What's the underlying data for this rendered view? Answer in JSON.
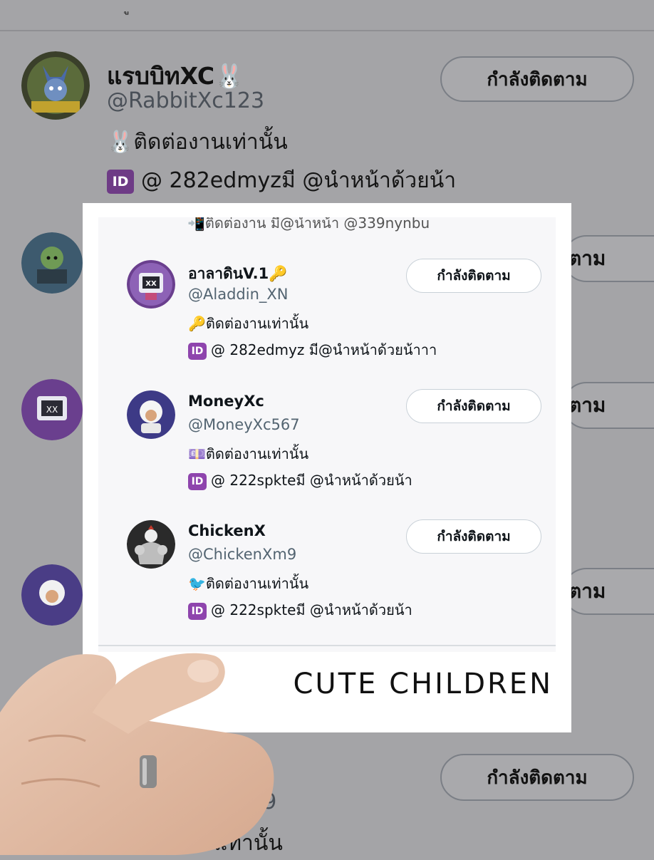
{
  "background": {
    "top_glyph": "ู",
    "first": {
      "name": "แรบบิทXC🐰",
      "handle": "@RabbitXc123",
      "bio": "🐰ติดต่องานเท่านั้น",
      "id_badge": "ID",
      "id_line": "@ 282edmyzมี @นำหน้าด้วยน้า",
      "follow_label": "กำลังติดตาม"
    },
    "partial_follow_label": "ตาม",
    "bottom": {
      "follow_label": "กำลังติดตาม",
      "handle_fragment": "enXm9",
      "bio_fragment": "ดต่องานเท่านั้น"
    }
  },
  "card": {
    "cut_line": "📲ติดต่องาน มี@นำหน้า @339nynbu",
    "accounts": [
      {
        "name": "อาลาดินV.1🔑",
        "handle": "@Aladdin_XN",
        "bio": "🔑ติดต่องานเท่านั้น",
        "id_badge": "ID",
        "id_line": "@ 282edmyz มี@นำหน้าด้วยน้าาา",
        "follow_label": "กำลังติดตาม",
        "avatar_icon": "robot-avatar-icon"
      },
      {
        "name": "MoneyXc",
        "handle": "@MoneyXc567",
        "bio": "💷ติดต่องานเท่านั้น",
        "id_badge": "ID",
        "id_line": "@ 222spkteมี @นำหน้าด้วยน้า",
        "follow_label": "กำลังติดตาม",
        "avatar_icon": "cartoon-avatar-icon"
      },
      {
        "name": "ChickenX",
        "handle": "@ChickenXm9",
        "bio": "🐦ติดต่องานเท่านั้น",
        "id_badge": "ID",
        "id_line": "@ 222spkteมี @นำหน้าด้วยน้า",
        "follow_label": "กำลังติดตาม",
        "avatar_icon": "muscle-chicken-avatar-icon"
      }
    ],
    "caption": "CUTE CHILDREN"
  },
  "colors": {
    "id_badge": "#8e44ad",
    "handle": "#536471",
    "button_border": "#c9d1d8"
  }
}
